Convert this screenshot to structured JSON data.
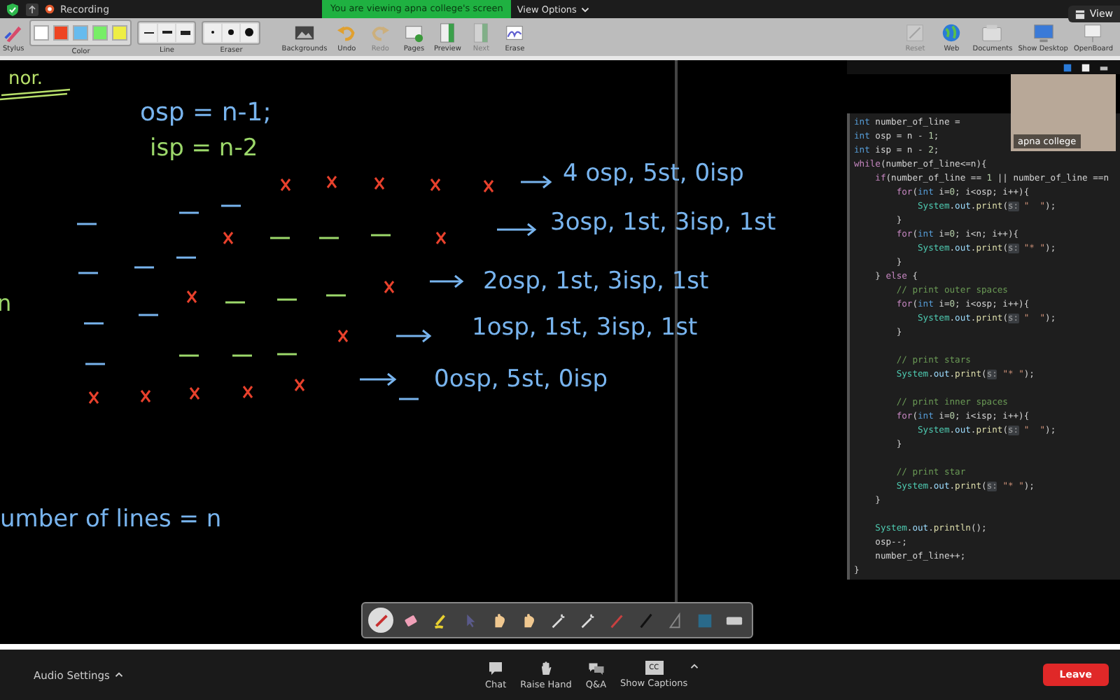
{
  "top_bar": {
    "recording": "Recording",
    "banner": "You are viewing apna college's screen",
    "view_options": "View Options",
    "view": "View"
  },
  "toolbar": {
    "stylus": "Stylus",
    "color": {
      "label": "Color",
      "swatches": [
        {
          "color": "#ffffff"
        },
        {
          "color": "#ee4422"
        },
        {
          "color": "#66bbee"
        },
        {
          "color": "#77ee66"
        },
        {
          "color": "#eeee44"
        }
      ]
    },
    "line": "Line",
    "eraser": "Eraser",
    "tools": [
      {
        "label": "Backgrounds",
        "disabled": false
      },
      {
        "label": "Undo",
        "disabled": false
      },
      {
        "label": "Redo",
        "disabled": true
      },
      {
        "label": "Pages",
        "disabled": false
      },
      {
        "label": "Preview",
        "disabled": false
      },
      {
        "label": "Next",
        "disabled": true
      },
      {
        "label": "Erase",
        "disabled": false
      }
    ],
    "right_tools": [
      {
        "label": "Reset",
        "disabled": true
      },
      {
        "label": "Web",
        "disabled": false
      },
      {
        "label": "Documents",
        "disabled": false
      },
      {
        "label": "Show Desktop",
        "disabled": false
      },
      {
        "label": "OpenBoard",
        "disabled": false
      }
    ]
  },
  "whiteboard": {
    "notes": [
      {
        "text": "nor.",
        "color": "#b8e06a"
      },
      {
        "text": "osp = n-1;",
        "color": "#78b4ee"
      },
      {
        "text": "isp = n-2",
        "color": "#9cd86a"
      },
      {
        "text": "4 osp, 5st, 0isp",
        "color": "#78b4ee"
      },
      {
        "text": "3osp, 1st, 3isp, 1st",
        "color": "#78b4ee"
      },
      {
        "text": "2osp, 1st, 3isp, 1st",
        "color": "#78b4ee"
      },
      {
        "text": "1osp, 1st, 3isp, 1st",
        "color": "#78b4ee"
      },
      {
        "text": "0osp, 5st, 0isp",
        "color": "#78b4ee"
      },
      {
        "text": "n",
        "color": "#9cd86a"
      },
      {
        "text": "umber of lines = n",
        "color": "#78b4ee"
      }
    ]
  },
  "code": {
    "lines": [
      {
        "kind": "code",
        "parts": [
          {
            "text": "int",
            "kind": "type"
          },
          {
            "text": " number_of_line =",
            "kind": "pl"
          }
        ]
      },
      {
        "kind": "code",
        "parts": [
          {
            "text": "int",
            "kind": "type"
          },
          {
            "text": " osp = n - ",
            "kind": "pl"
          },
          {
            "text": "1",
            "kind": "num"
          },
          {
            "text": ";",
            "kind": "pl"
          }
        ]
      },
      {
        "kind": "code",
        "parts": [
          {
            "text": "int",
            "kind": "type"
          },
          {
            "text": " isp = n - ",
            "kind": "pl"
          },
          {
            "text": "2",
            "kind": "num"
          },
          {
            "text": ";",
            "kind": "pl"
          }
        ]
      },
      {
        "kind": "code",
        "parts": [
          {
            "text": "while",
            "kind": "ctl"
          },
          {
            "text": "(number_of_line<=n){",
            "kind": "pl"
          }
        ]
      },
      {
        "kind": "code",
        "parts": [
          {
            "text": "    if",
            "kind": "ctl"
          },
          {
            "text": "(number_of_line == ",
            "kind": "pl"
          },
          {
            "text": "1",
            "kind": "num"
          },
          {
            "text": " || number_of_line ==n",
            "kind": "pl"
          }
        ]
      },
      {
        "kind": "code",
        "parts": [
          {
            "text": "        for",
            "kind": "ctl"
          },
          {
            "text": "(",
            "kind": "pl"
          },
          {
            "text": "int",
            "kind": "type"
          },
          {
            "text": " i=",
            "kind": "pl"
          },
          {
            "text": "0",
            "kind": "num"
          },
          {
            "text": "; i<osp; i++){",
            "kind": "pl"
          }
        ]
      },
      {
        "kind": "code",
        "parts": [
          {
            "text": "            System",
            "kind": "cls"
          },
          {
            "text": ".",
            "kind": "pl"
          },
          {
            "text": "out",
            "kind": "fld"
          },
          {
            "text": ".",
            "kind": "pl"
          },
          {
            "text": "print",
            "kind": "fn"
          },
          {
            "text": "(",
            "kind": "pl"
          },
          {
            "text": "s:",
            "kind": "hint"
          },
          {
            "text": " \"  \"",
            "kind": "str"
          },
          {
            "text": ");",
            "kind": "pl"
          }
        ]
      },
      {
        "kind": "code",
        "parts": [
          {
            "text": "        }",
            "kind": "pl"
          }
        ]
      },
      {
        "kind": "code",
        "parts": [
          {
            "text": "        for",
            "kind": "ctl"
          },
          {
            "text": "(",
            "kind": "pl"
          },
          {
            "text": "int",
            "kind": "type"
          },
          {
            "text": " i=",
            "kind": "pl"
          },
          {
            "text": "0",
            "kind": "num"
          },
          {
            "text": "; i<n; i++){",
            "kind": "pl"
          }
        ]
      },
      {
        "kind": "code",
        "parts": [
          {
            "text": "            System",
            "kind": "cls"
          },
          {
            "text": ".",
            "kind": "pl"
          },
          {
            "text": "out",
            "kind": "fld"
          },
          {
            "text": ".",
            "kind": "pl"
          },
          {
            "text": "print",
            "kind": "fn"
          },
          {
            "text": "(",
            "kind": "pl"
          },
          {
            "text": "s:",
            "kind": "hint"
          },
          {
            "text": " \"* \"",
            "kind": "str"
          },
          {
            "text": ");",
            "kind": "pl"
          }
        ]
      },
      {
        "kind": "code",
        "parts": [
          {
            "text": "        }",
            "kind": "pl"
          }
        ]
      },
      {
        "kind": "code",
        "parts": [
          {
            "text": "    } ",
            "kind": "pl"
          },
          {
            "text": "else",
            "kind": "ctl"
          },
          {
            "text": " {",
            "kind": "pl"
          }
        ]
      },
      {
        "kind": "code",
        "parts": [
          {
            "text": "        // print outer spaces",
            "kind": "cm"
          }
        ]
      },
      {
        "kind": "code",
        "parts": [
          {
            "text": "        for",
            "kind": "ctl"
          },
          {
            "text": "(",
            "kind": "pl"
          },
          {
            "text": "int",
            "kind": "type"
          },
          {
            "text": " i=",
            "kind": "pl"
          },
          {
            "text": "0",
            "kind": "num"
          },
          {
            "text": "; i<osp; i++){",
            "kind": "pl"
          }
        ]
      },
      {
        "kind": "code",
        "parts": [
          {
            "text": "            System",
            "kind": "cls"
          },
          {
            "text": ".",
            "kind": "pl"
          },
          {
            "text": "out",
            "kind": "fld"
          },
          {
            "text": ".",
            "kind": "pl"
          },
          {
            "text": "print",
            "kind": "fn"
          },
          {
            "text": "(",
            "kind": "pl"
          },
          {
            "text": "s:",
            "kind": "hint"
          },
          {
            "text": " \"  \"",
            "kind": "str"
          },
          {
            "text": ");",
            "kind": "pl"
          }
        ]
      },
      {
        "kind": "code",
        "parts": [
          {
            "text": "        }",
            "kind": "pl"
          }
        ]
      },
      {
        "kind": "blank"
      },
      {
        "kind": "code",
        "parts": [
          {
            "text": "        // print stars",
            "kind": "cm"
          }
        ]
      },
      {
        "kind": "code",
        "parts": [
          {
            "text": "        System",
            "kind": "cls"
          },
          {
            "text": ".",
            "kind": "pl"
          },
          {
            "text": "out",
            "kind": "fld"
          },
          {
            "text": ".",
            "kind": "pl"
          },
          {
            "text": "print",
            "kind": "fn"
          },
          {
            "text": "(",
            "kind": "pl"
          },
          {
            "text": "s:",
            "kind": "hint"
          },
          {
            "text": " \"* \"",
            "kind": "str"
          },
          {
            "text": ");",
            "kind": "pl"
          }
        ]
      },
      {
        "kind": "blank"
      },
      {
        "kind": "code",
        "parts": [
          {
            "text": "        // print inner spaces",
            "kind": "cm"
          }
        ]
      },
      {
        "kind": "code",
        "parts": [
          {
            "text": "        for",
            "kind": "ctl"
          },
          {
            "text": "(",
            "kind": "pl"
          },
          {
            "text": "int",
            "kind": "type"
          },
          {
            "text": " i=",
            "kind": "pl"
          },
          {
            "text": "0",
            "kind": "num"
          },
          {
            "text": "; i<isp; i++){",
            "kind": "pl"
          }
        ]
      },
      {
        "kind": "code",
        "parts": [
          {
            "text": "            System",
            "kind": "cls"
          },
          {
            "text": ".",
            "kind": "pl"
          },
          {
            "text": "out",
            "kind": "fld"
          },
          {
            "text": ".",
            "kind": "pl"
          },
          {
            "text": "print",
            "kind": "fn"
          },
          {
            "text": "(",
            "kind": "pl"
          },
          {
            "text": "s:",
            "kind": "hint"
          },
          {
            "text": " \"  \"",
            "kind": "str"
          },
          {
            "text": ");",
            "kind": "pl"
          }
        ]
      },
      {
        "kind": "code",
        "parts": [
          {
            "text": "        }",
            "kind": "pl"
          }
        ]
      },
      {
        "kind": "blank"
      },
      {
        "kind": "code",
        "parts": [
          {
            "text": "        // print star",
            "kind": "cm"
          }
        ]
      },
      {
        "kind": "code",
        "parts": [
          {
            "text": "        System",
            "kind": "cls"
          },
          {
            "text": ".",
            "kind": "pl"
          },
          {
            "text": "out",
            "kind": "fld"
          },
          {
            "text": ".",
            "kind": "pl"
          },
          {
            "text": "print",
            "kind": "fn"
          },
          {
            "text": "(",
            "kind": "pl"
          },
          {
            "text": "s:",
            "kind": "hint"
          },
          {
            "text": " \"* \"",
            "kind": "str"
          },
          {
            "text": ");",
            "kind": "pl"
          }
        ]
      },
      {
        "kind": "code",
        "parts": [
          {
            "text": "    }",
            "kind": "pl"
          }
        ]
      },
      {
        "kind": "blank"
      },
      {
        "kind": "code",
        "parts": [
          {
            "text": "    System",
            "kind": "cls"
          },
          {
            "text": ".",
            "kind": "pl"
          },
          {
            "text": "out",
            "kind": "fld"
          },
          {
            "text": ".",
            "kind": "pl"
          },
          {
            "text": "println",
            "kind": "fn"
          },
          {
            "text": "();",
            "kind": "pl"
          }
        ]
      },
      {
        "kind": "code",
        "parts": [
          {
            "text": "    osp--;",
            "kind": "pl"
          }
        ]
      },
      {
        "kind": "code",
        "parts": [
          {
            "text": "    number_of_line++;",
            "kind": "pl"
          }
        ]
      },
      {
        "kind": "code",
        "parts": [
          {
            "text": "}",
            "kind": "pl"
          }
        ]
      }
    ]
  },
  "video": {
    "name": "apna college"
  },
  "annotation_tools": [
    {
      "selected": true
    },
    {
      "selected": false
    },
    {
      "selected": false
    },
    {
      "selected": false
    },
    {
      "selected": false
    },
    {
      "selected": false
    },
    {
      "selected": false
    },
    {
      "selected": false
    },
    {
      "selected": false
    },
    {
      "selected": false
    },
    {
      "selected": false
    },
    {
      "selected": false
    },
    {
      "selected": false
    }
  ],
  "bottom_bar": {
    "audio_settings": "Audio Settings",
    "actions": [
      {
        "label": "Chat"
      },
      {
        "label": "Raise Hand"
      },
      {
        "label": "Q&A"
      },
      {
        "label": "Show Captions",
        "badge": "CC"
      }
    ],
    "leave": "Leave"
  }
}
